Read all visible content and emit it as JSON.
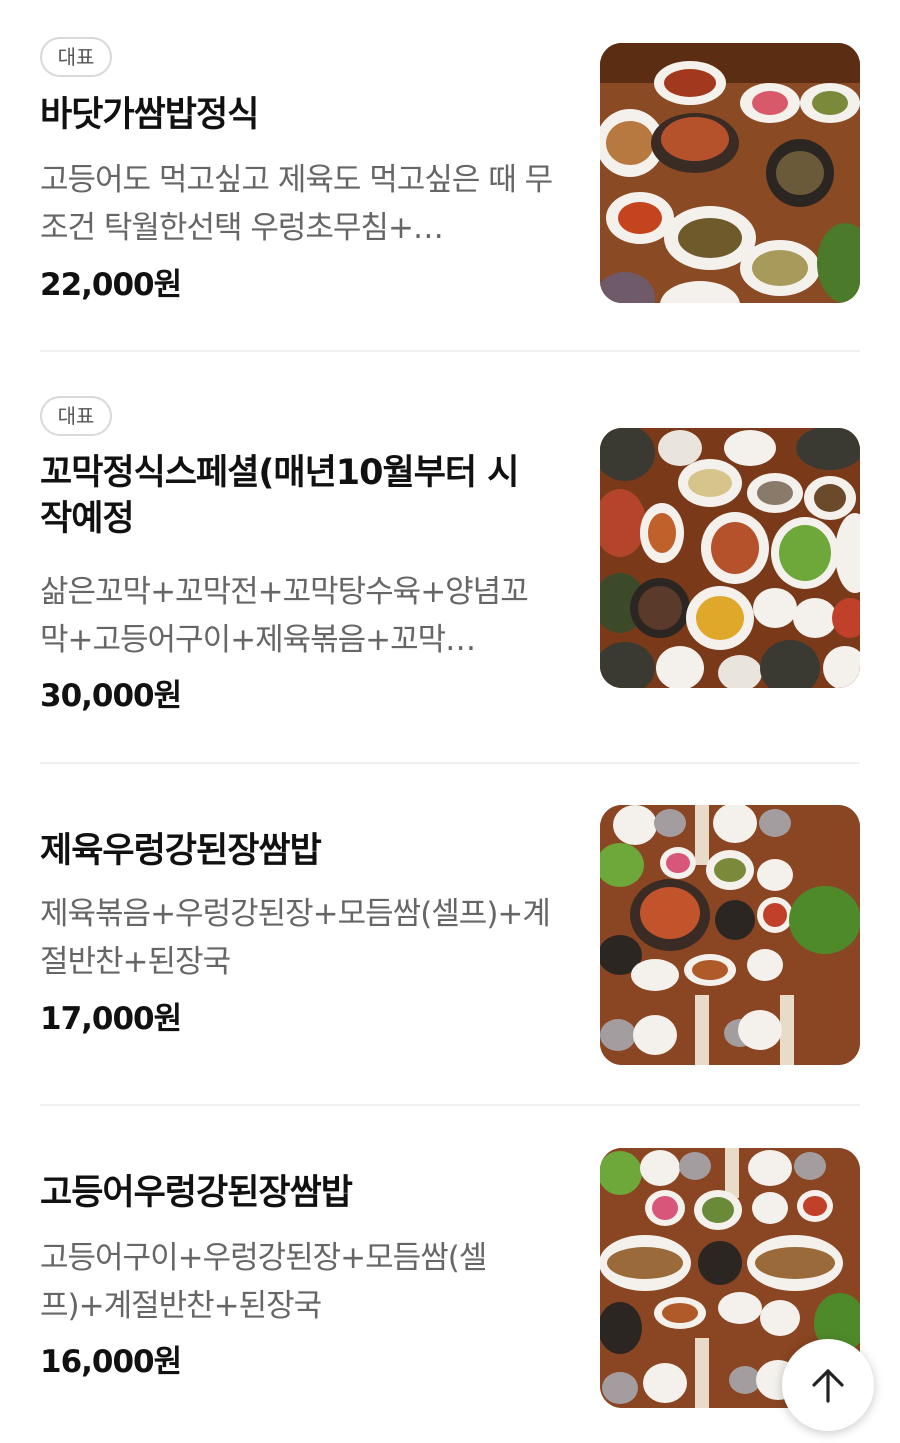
{
  "menu": [
    {
      "badge": "대표",
      "name": "바닷가쌈밥정식",
      "description": "고등어도 먹고싶고 제육도 먹고싶은 때 무조건 탁월한선택 우렁초무침+…",
      "price": "22,000원",
      "photo": "korean-table-setting-photo"
    },
    {
      "badge": "대표",
      "name": "꼬막정식스페셜(매년10월부터 시작예정",
      "description": "삶은꼬막+꼬막전+꼬막탕수육+양념꼬막+고등어구이+제육볶음+꼬막…",
      "price": "30,000원",
      "photo": "cockle-set-meal-photo"
    },
    {
      "badge": "",
      "name": "제육우렁강된장쌈밥",
      "description": "제육볶음+우렁강된장+모듬쌈(셀프)+계절반찬+된장국",
      "price": "17,000원",
      "photo": "pork-ssambap-photo"
    },
    {
      "badge": "",
      "name": "고등어우렁강된장쌈밥",
      "description": "고등어구이+우렁강된장+모듬쌈(셀프)+계절반찬+된장국",
      "price": "16,000원",
      "photo": "mackerel-ssambap-photo"
    }
  ],
  "scroll_top": {
    "icon": "arrow-up-icon"
  },
  "colors": {
    "table_wood": "#7a3b1c",
    "divider": "#f0f0f0",
    "badge_border": "#d9d9d9",
    "desc_text": "#666666"
  }
}
